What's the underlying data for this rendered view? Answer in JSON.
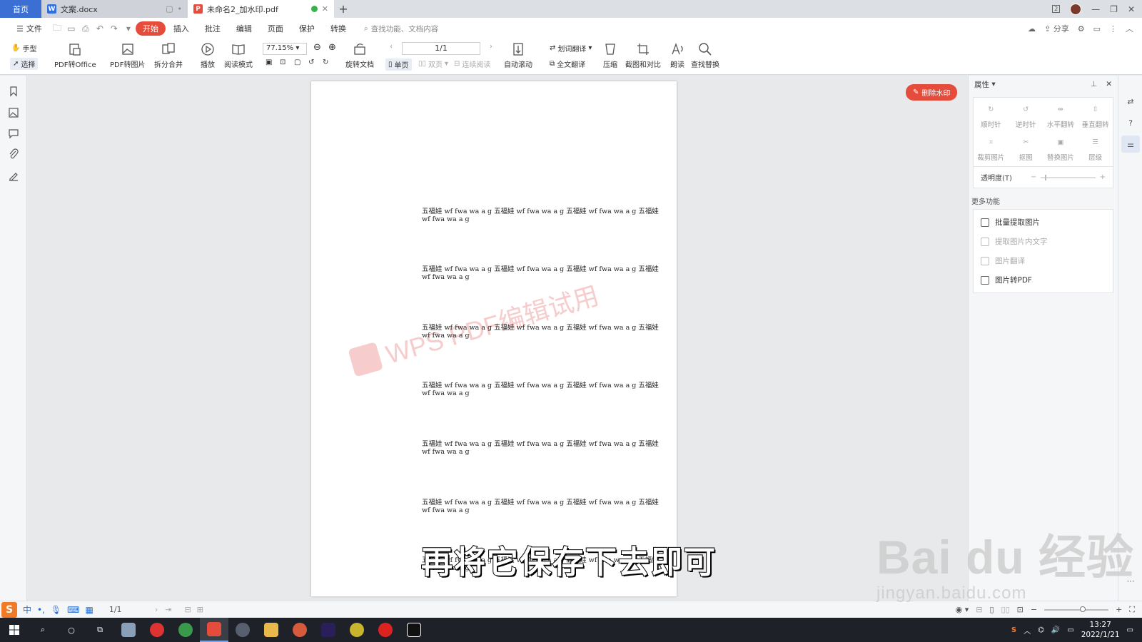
{
  "tabs": {
    "home": "首页",
    "doc_tab": "文案.docx",
    "pdf_tab": "未命名2_加水印.pdf",
    "new_tab": "+"
  },
  "menu": {
    "file": "文件",
    "items": [
      "开始",
      "插入",
      "批注",
      "编辑",
      "页面",
      "保护",
      "转换"
    ],
    "search_placeholder": "查找功能、文档内容",
    "share": "分享"
  },
  "ribbon": {
    "hand": "手型",
    "select": "选择",
    "pdf_to_office": "PDF转Office",
    "pdf_to_image": "PDF转图片",
    "split_merge": "拆分合并",
    "play": "播放",
    "read_mode": "阅读模式",
    "zoom_value": "77.15%",
    "rotate_doc": "旋转文档",
    "single_page": "单页",
    "double_page": "双页",
    "continuous": "连续阅读",
    "page_value": "1/1",
    "auto_scroll": "自动滚动",
    "word_translate": "划词翻译",
    "full_translate": "全文翻译",
    "compress": "压缩",
    "screenshot_compare": "截图和对比",
    "read_aloud": "朗读",
    "find_replace": "查找替换"
  },
  "document": {
    "paragraphs": [
      "五福娃 wf fwa wa a g 五福娃 wf fwa wa a g 五福娃 wf fwa wa a g 五福娃 wf fwa wa a g",
      "五福娃 wf fwa wa a g 五福娃 wf fwa wa a g 五福娃 wf fwa wa a g 五福娃 wf fwa wa a g",
      "五福娃 wf fwa wa a g 五福娃 wf fwa wa a g 五福娃 wf fwa wa a g 五福娃 wf fwa wa a g",
      "五福娃 wf fwa wa a g 五福娃 wf fwa wa a g 五福娃 wf fwa wa a g 五福娃 wf fwa wa a g",
      "五福娃 wf fwa wa a g 五福娃 wf fwa wa a g 五福娃 wf fwa wa a g 五福娃 wf fwa wa a g",
      "五福娃 wf fwa wa a g 五福娃 wf fwa wa a g 五福娃 wf fwa wa a g 五福娃 wf fwa wa a g",
      "五福娃 wf fwa wa a g 五福娃 wf fwa wa a g 五福娃 wf fwa wa a g 五福娃 wf fwa wa a g"
    ],
    "watermark_text": "WPS PDF编辑试用",
    "delete_watermark": "删除水印"
  },
  "panel": {
    "title": "属性",
    "tools": [
      "顺时针",
      "逆时针",
      "水平翻转",
      "垂直翻转",
      "裁剪图片",
      "抠图",
      "替换图片",
      "层级"
    ],
    "opacity_label": "透明度(T)",
    "more_label": "更多功能",
    "more_items": [
      {
        "label": "批量提取图片",
        "enabled": true
      },
      {
        "label": "提取图片内文字",
        "enabled": false
      },
      {
        "label": "图片翻译",
        "enabled": false
      },
      {
        "label": "图片转PDF",
        "enabled": true
      }
    ]
  },
  "statusbar": {
    "ime_mode": "中",
    "page": "1/1"
  },
  "subtitle": "再将它保存下去即可",
  "baidu": {
    "brand": "Bai du 经验",
    "url": "jingyan.baidu.com"
  },
  "taskbar": {
    "time": "13:27",
    "date": "2022/1/21"
  },
  "colors": {
    "accent_red": "#e64c3c",
    "home_tab_blue": "#3b6fd4",
    "taskbar_bg": "#1e2127"
  }
}
